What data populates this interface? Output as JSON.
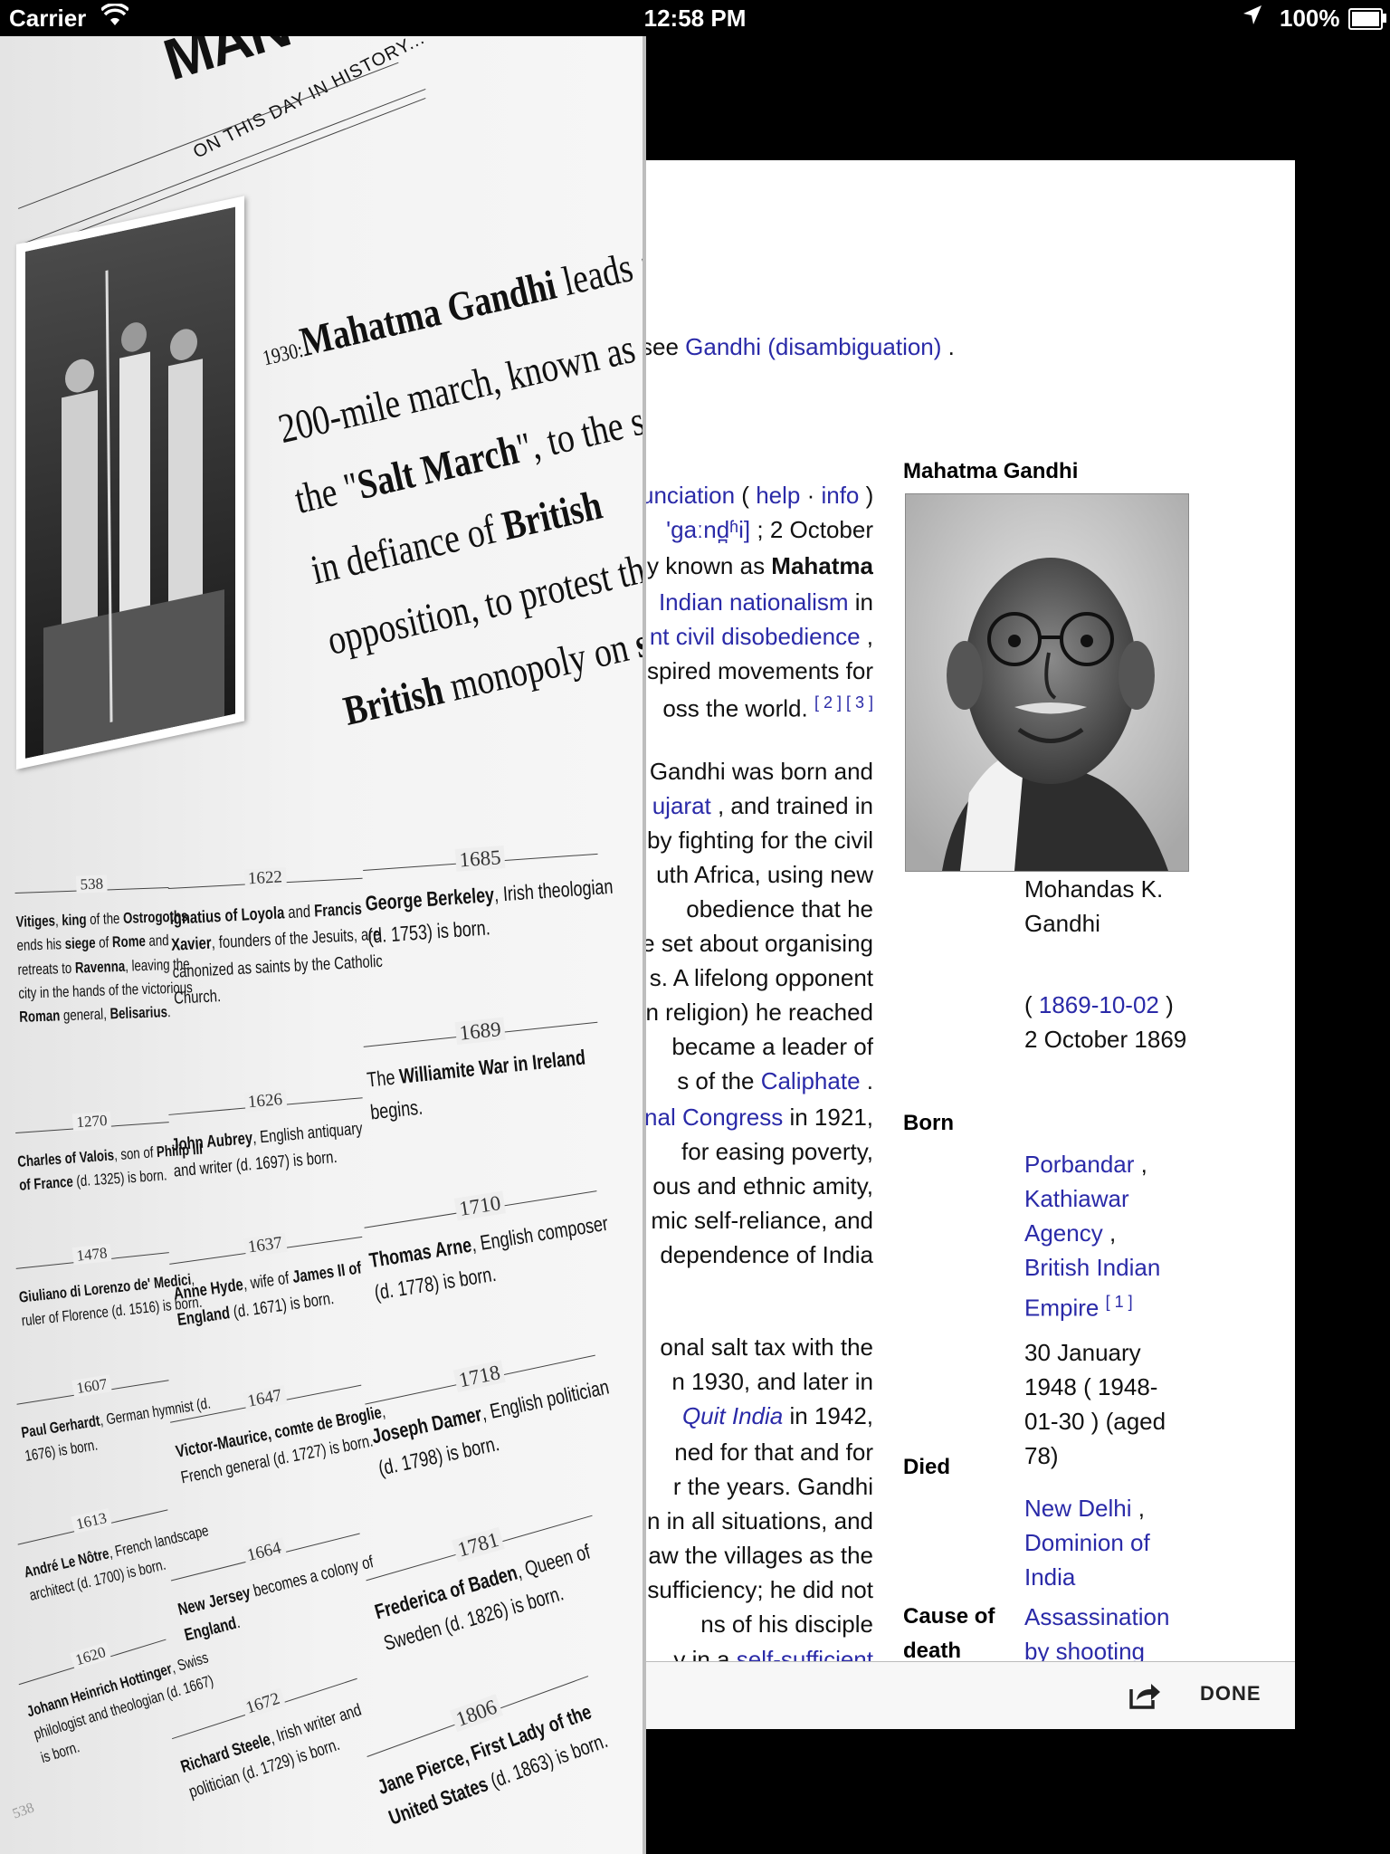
{
  "status_bar": {
    "carrier": "Carrier",
    "time": "12:58 PM",
    "battery": "100%"
  },
  "wiki": {
    "hatnote": {
      "prefix": "see ",
      "link": "Gandhi (disambiguation)",
      "suffix": " ."
    },
    "lines": [
      {
        "parts": [
          {
            "t": "unciation",
            "l": true
          },
          {
            "t": "  ( "
          },
          {
            "t": "help",
            "l": true
          },
          {
            "t": " · "
          },
          {
            "t": "info",
            "l": true
          },
          {
            "t": " )"
          }
        ]
      },
      {
        "parts": [
          {
            "t": "'gaːnd̪ʱi]",
            "l": true
          },
          {
            "t": " ; 2 October"
          }
        ]
      },
      {
        "parts": [
          {
            "t": "y known as "
          },
          {
            "t": "Mahatma",
            "b": true
          }
        ]
      },
      {
        "parts": [
          {
            "t": "Indian nationalism",
            "l": true
          },
          {
            "t": " in"
          }
        ]
      },
      {
        "parts": [
          {
            "t": "nt civil disobedience",
            "l": true
          },
          {
            "t": " ,"
          }
        ]
      },
      {
        "parts": [
          {
            "t": "spired movements for"
          }
        ]
      },
      {
        "parts": [
          {
            "t": "oss the world. "
          },
          {
            "t": "[ 2 ] [ 3 ]",
            "sup": true
          }
        ]
      },
      {
        "parts": [
          {
            "t": "Gandhi was born and"
          }
        ]
      },
      {
        "parts": [
          {
            "t": "ujarat",
            "l": true
          },
          {
            "t": " , and trained in"
          }
        ]
      },
      {
        "parts": [
          {
            "t": "by fighting for the civil"
          }
        ]
      },
      {
        "parts": [
          {
            "t": "uth Africa, using new"
          }
        ]
      },
      {
        "parts": [
          {
            "t": "obedience   that   he"
          }
        ]
      },
      {
        "parts": [
          {
            "t": "e set about organising"
          }
        ]
      },
      {
        "parts": [
          {
            "t": "s. A lifelong opponent"
          }
        ]
      },
      {
        "parts": [
          {
            "t": "n religion) he reached"
          }
        ]
      },
      {
        "parts": [
          {
            "t": "became a leader of"
          }
        ]
      },
      {
        "parts": [
          {
            "t": "s of the "
          },
          {
            "t": "Caliphate",
            "l": true
          },
          {
            "t": " ."
          }
        ]
      },
      {
        "parts": [
          {
            "t": "nal Congress",
            "l": true
          },
          {
            "t": " in 1921,"
          }
        ]
      },
      {
        "parts": [
          {
            "t": "for   easing   poverty,"
          }
        ]
      },
      {
        "parts": [
          {
            "t": "ous and ethnic amity,"
          }
        ]
      },
      {
        "parts": [
          {
            "t": "mic self-reliance, and"
          }
        ]
      },
      {
        "parts": [
          {
            "t": "dependence of India"
          }
        ]
      },
      {
        "parts": [
          {
            "t": "onal salt tax with the"
          }
        ]
      },
      {
        "parts": [
          {
            "t": "n 1930, and later in"
          }
        ]
      },
      {
        "parts": [
          {
            "t": "Quit India",
            "l": true,
            "i": true
          },
          {
            "t": "  in 1942,"
          }
        ]
      },
      {
        "parts": [
          {
            "t": "ned for that and for"
          }
        ]
      },
      {
        "parts": [
          {
            "t": "r  the  years.  Gandhi"
          }
        ]
      },
      {
        "parts": [
          {
            "t": "n in all situations, and"
          }
        ]
      },
      {
        "parts": [
          {
            "t": "aw the villages as the"
          }
        ]
      },
      {
        "parts": [
          {
            "t": "sufficiency; he did not"
          }
        ]
      },
      {
        "parts": [
          {
            "t": "ns   of   his   disciple"
          }
        ]
      },
      {
        "parts": [
          {
            "t": "y  in  a  "
          },
          {
            "t": "self-sufficient",
            "l": true
          }
        ]
      }
    ],
    "infobox": {
      "title": "Mahatma Gandhi",
      "name_lines": [
        "Mohandas K.",
        "Gandhi"
      ],
      "born_label": "Born",
      "born_date_link": "1869-10-02",
      "born_date_text": "2 October 1869",
      "born_place": [
        "Porbandar",
        "Kathiawar",
        "Agency",
        "British Indian",
        "Empire"
      ],
      "born_ref": "[ 1 ]",
      "died_label": "Died",
      "died_date": "30 January 1948 ( 1948-01-30 ) (aged 78)",
      "died_place": [
        "New Delhi",
        "Dominion of",
        "India"
      ],
      "cause_label": "Cause of death",
      "cause_value": "Assassination by shooting"
    },
    "toolbar": {
      "done": "DONE"
    }
  },
  "history": {
    "header_title": "MAN",
    "subtitle": "ON THIS DAY IN HISTORY...",
    "year": "1930:",
    "headline_lines": [
      [
        {
          "t": "Mahatma Gandhi",
          "b": true
        },
        {
          "t": " leads a"
        }
      ],
      [
        {
          "t": "200-mile march, known as"
        }
      ],
      [
        {
          "t": "the \""
        },
        {
          "t": "Salt March",
          "b": true
        },
        {
          "t": "\", to the sea"
        }
      ],
      [
        {
          "t": "in defiance of "
        },
        {
          "t": "British",
          "b": true
        }
      ],
      [
        {
          "t": "opposition, to protest the"
        }
      ],
      [
        {
          "t": "British",
          "b": true
        },
        {
          "t": " monopoly on "
        },
        {
          "t": "salt.",
          "b": true
        }
      ]
    ],
    "events_col1": [
      {
        "year": "538",
        "html": [
          [
            "Vitiges",
            "b"
          ],
          [
            ", "
          ],
          [
            "king",
            "b"
          ],
          [
            " of the "
          ],
          [
            "Ostrogoths",
            "b"
          ],
          [
            "|ends his "
          ],
          [
            "siege",
            "b"
          ],
          [
            " of "
          ],
          [
            "Rome",
            "b"
          ],
          [
            " and|retreats to "
          ],
          [
            "Ravenna",
            "b"
          ],
          [
            ", leaving the|city in the hands of the victorious|"
          ],
          [
            "Roman",
            "b"
          ],
          [
            " general, "
          ],
          [
            "Belisarius",
            "b"
          ],
          [
            "."
          ]
        ]
      },
      {
        "year": "1270",
        "html": [
          [
            "Charles of Valois",
            "b"
          ],
          [
            ", son of "
          ],
          [
            "Philip III",
            "b"
          ],
          [
            "|"
          ],
          [
            "of France",
            "b"
          ],
          [
            " (d. 1325) is born."
          ]
        ]
      },
      {
        "year": "1478",
        "html": [
          [
            "Giuliano di Lorenzo de' Medici",
            "b"
          ],
          [
            ",|ruler of Florence (d. 1516) is born."
          ]
        ]
      },
      {
        "year": "1607",
        "html": [
          [
            "Paul Gerhardt",
            "b"
          ],
          [
            ", German hymnist (d.|1676) is born."
          ]
        ]
      },
      {
        "year": "1613",
        "html": [
          [
            "André Le Nôtre",
            "b"
          ],
          [
            ", French landscape|architect (d. 1700) is born."
          ]
        ]
      },
      {
        "year": "1620",
        "html": [
          [
            "Johann Heinrich Hottinger",
            "b"
          ],
          [
            ", Swiss|philologist and theologian (d. 1667)|is born."
          ]
        ]
      }
    ],
    "events_col2": [
      {
        "year": "1622",
        "html": [
          [
            "Ignatius of Loyola",
            "b"
          ],
          [
            " and "
          ],
          [
            "Francis",
            "b"
          ],
          [
            "|"
          ],
          [
            "Xavier",
            "b"
          ],
          [
            ", founders of the Jesuits, are|canonized as saints by the Catholic|Church."
          ]
        ]
      },
      {
        "year": "1626",
        "html": [
          [
            "John Aubrey",
            "b"
          ],
          [
            ", English antiquary|and writer (d. 1697) is born."
          ]
        ]
      },
      {
        "year": "1637",
        "html": [
          [
            "Anne Hyde",
            "b"
          ],
          [
            ", wife of "
          ],
          [
            "James II of",
            "b"
          ],
          [
            "|"
          ],
          [
            "England",
            "b"
          ],
          [
            " (d. 1671) is born."
          ]
        ]
      },
      {
        "year": "1647",
        "html": [
          [
            "Victor-Maurice, comte de Broglie",
            "b"
          ],
          [
            ",|French general (d. 1727) is born."
          ]
        ]
      },
      {
        "year": "1664",
        "html": [
          [
            "New Jersey",
            "b"
          ],
          [
            " becomes a colony of|"
          ],
          [
            "England",
            "b"
          ],
          [
            "."
          ]
        ]
      },
      {
        "year": "1672",
        "html": [
          [
            "Richard Steele",
            "b"
          ],
          [
            ", Irish writer and|politician (d. 1729) is born."
          ]
        ]
      }
    ],
    "events_col3": [
      {
        "year": "1685",
        "html": [
          [
            "George Berkeley",
            "b"
          ],
          [
            ", Irish theologian|(d. 1753) is born."
          ]
        ]
      },
      {
        "year": "1689",
        "html": [
          [
            "The "
          ],
          [
            "Williamite War in Ireland",
            "b"
          ],
          [
            "|begins."
          ]
        ]
      },
      {
        "year": "1710",
        "html": [
          [
            "Thomas Arne",
            "b"
          ],
          [
            ", English composer|(d. 1778) is born."
          ]
        ]
      },
      {
        "year": "1718",
        "html": [
          [
            "Joseph Damer",
            "b"
          ],
          [
            ", English politician|(d. 1798) is born."
          ]
        ]
      },
      {
        "year": "1781",
        "html": [
          [
            "Frederica of Baden",
            "b"
          ],
          [
            ", Queen of|Sweden (d. 1826) is born."
          ]
        ]
      },
      {
        "year": "1806",
        "html": [
          [
            "Jane Pierce, First Lady of the|United States",
            "b"
          ],
          [
            " (d. 1863) is born."
          ]
        ]
      }
    ],
    "footer_number": "538"
  }
}
